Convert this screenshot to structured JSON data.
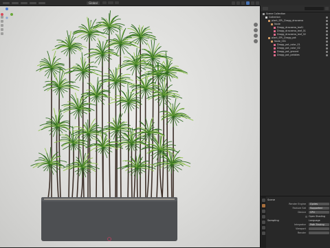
{
  "header": {
    "orientation": "Global",
    "editor_type_icon": "editor-type-icon"
  },
  "viewport": {
    "view_label": "",
    "background": "#dcdcda",
    "planter_color": "#4d4f52",
    "leaf_dark": "#2f6b1f",
    "leaf_light": "#8fc24a",
    "stem_color": "#3b2d26"
  },
  "outliner": {
    "rows": [
      {
        "label": "Scene Collection",
        "icon": "scene",
        "indent": 0
      },
      {
        "label": "Collection",
        "icon": "coll",
        "indent": 1
      },
      {
        "label": "plant_SPL_Dragg_dracaena",
        "icon": "empty",
        "indent": 2
      },
      {
        "label": "Node",
        "icon": "empty",
        "indent": 3
      },
      {
        "label": "Dragg_dracaena_leaf1",
        "icon": "mesh",
        "indent": 4
      },
      {
        "label": "Dragg_dracaena_leaf_01",
        "icon": "mesh",
        "indent": 4
      },
      {
        "label": "Dragg_dracaena_leaf_02",
        "icon": "mesh",
        "indent": 4
      },
      {
        "label": "plant_SPL_Dragg_pot",
        "icon": "empty",
        "indent": 2
      },
      {
        "label": "Node_001",
        "icon": "empty",
        "indent": 3
      },
      {
        "label": "Dragg_pot_color_01",
        "icon": "mesh",
        "indent": 4
      },
      {
        "label": "Dragg_pot_color_02",
        "icon": "mesh",
        "indent": 4
      },
      {
        "label": "Dragg_pot_ground",
        "icon": "mesh",
        "indent": 4
      },
      {
        "label": "Dragg_pot_pebbles",
        "icon": "mesh",
        "indent": 4
      }
    ]
  },
  "properties": {
    "section": "Scene",
    "rows": [
      {
        "label": "Render Engine",
        "value": "Cycles"
      },
      {
        "label": "Feature Set",
        "value": "Supported"
      },
      {
        "label": "Device",
        "value": "CPU"
      }
    ],
    "checkbox": "Open Shading Language",
    "subsection": "Sampling",
    "rows2": [
      {
        "label": "Integrator",
        "value": "Path Tracing"
      },
      {
        "label": "Viewport",
        "value": ""
      },
      {
        "label": "Render",
        "value": ""
      }
    ]
  }
}
